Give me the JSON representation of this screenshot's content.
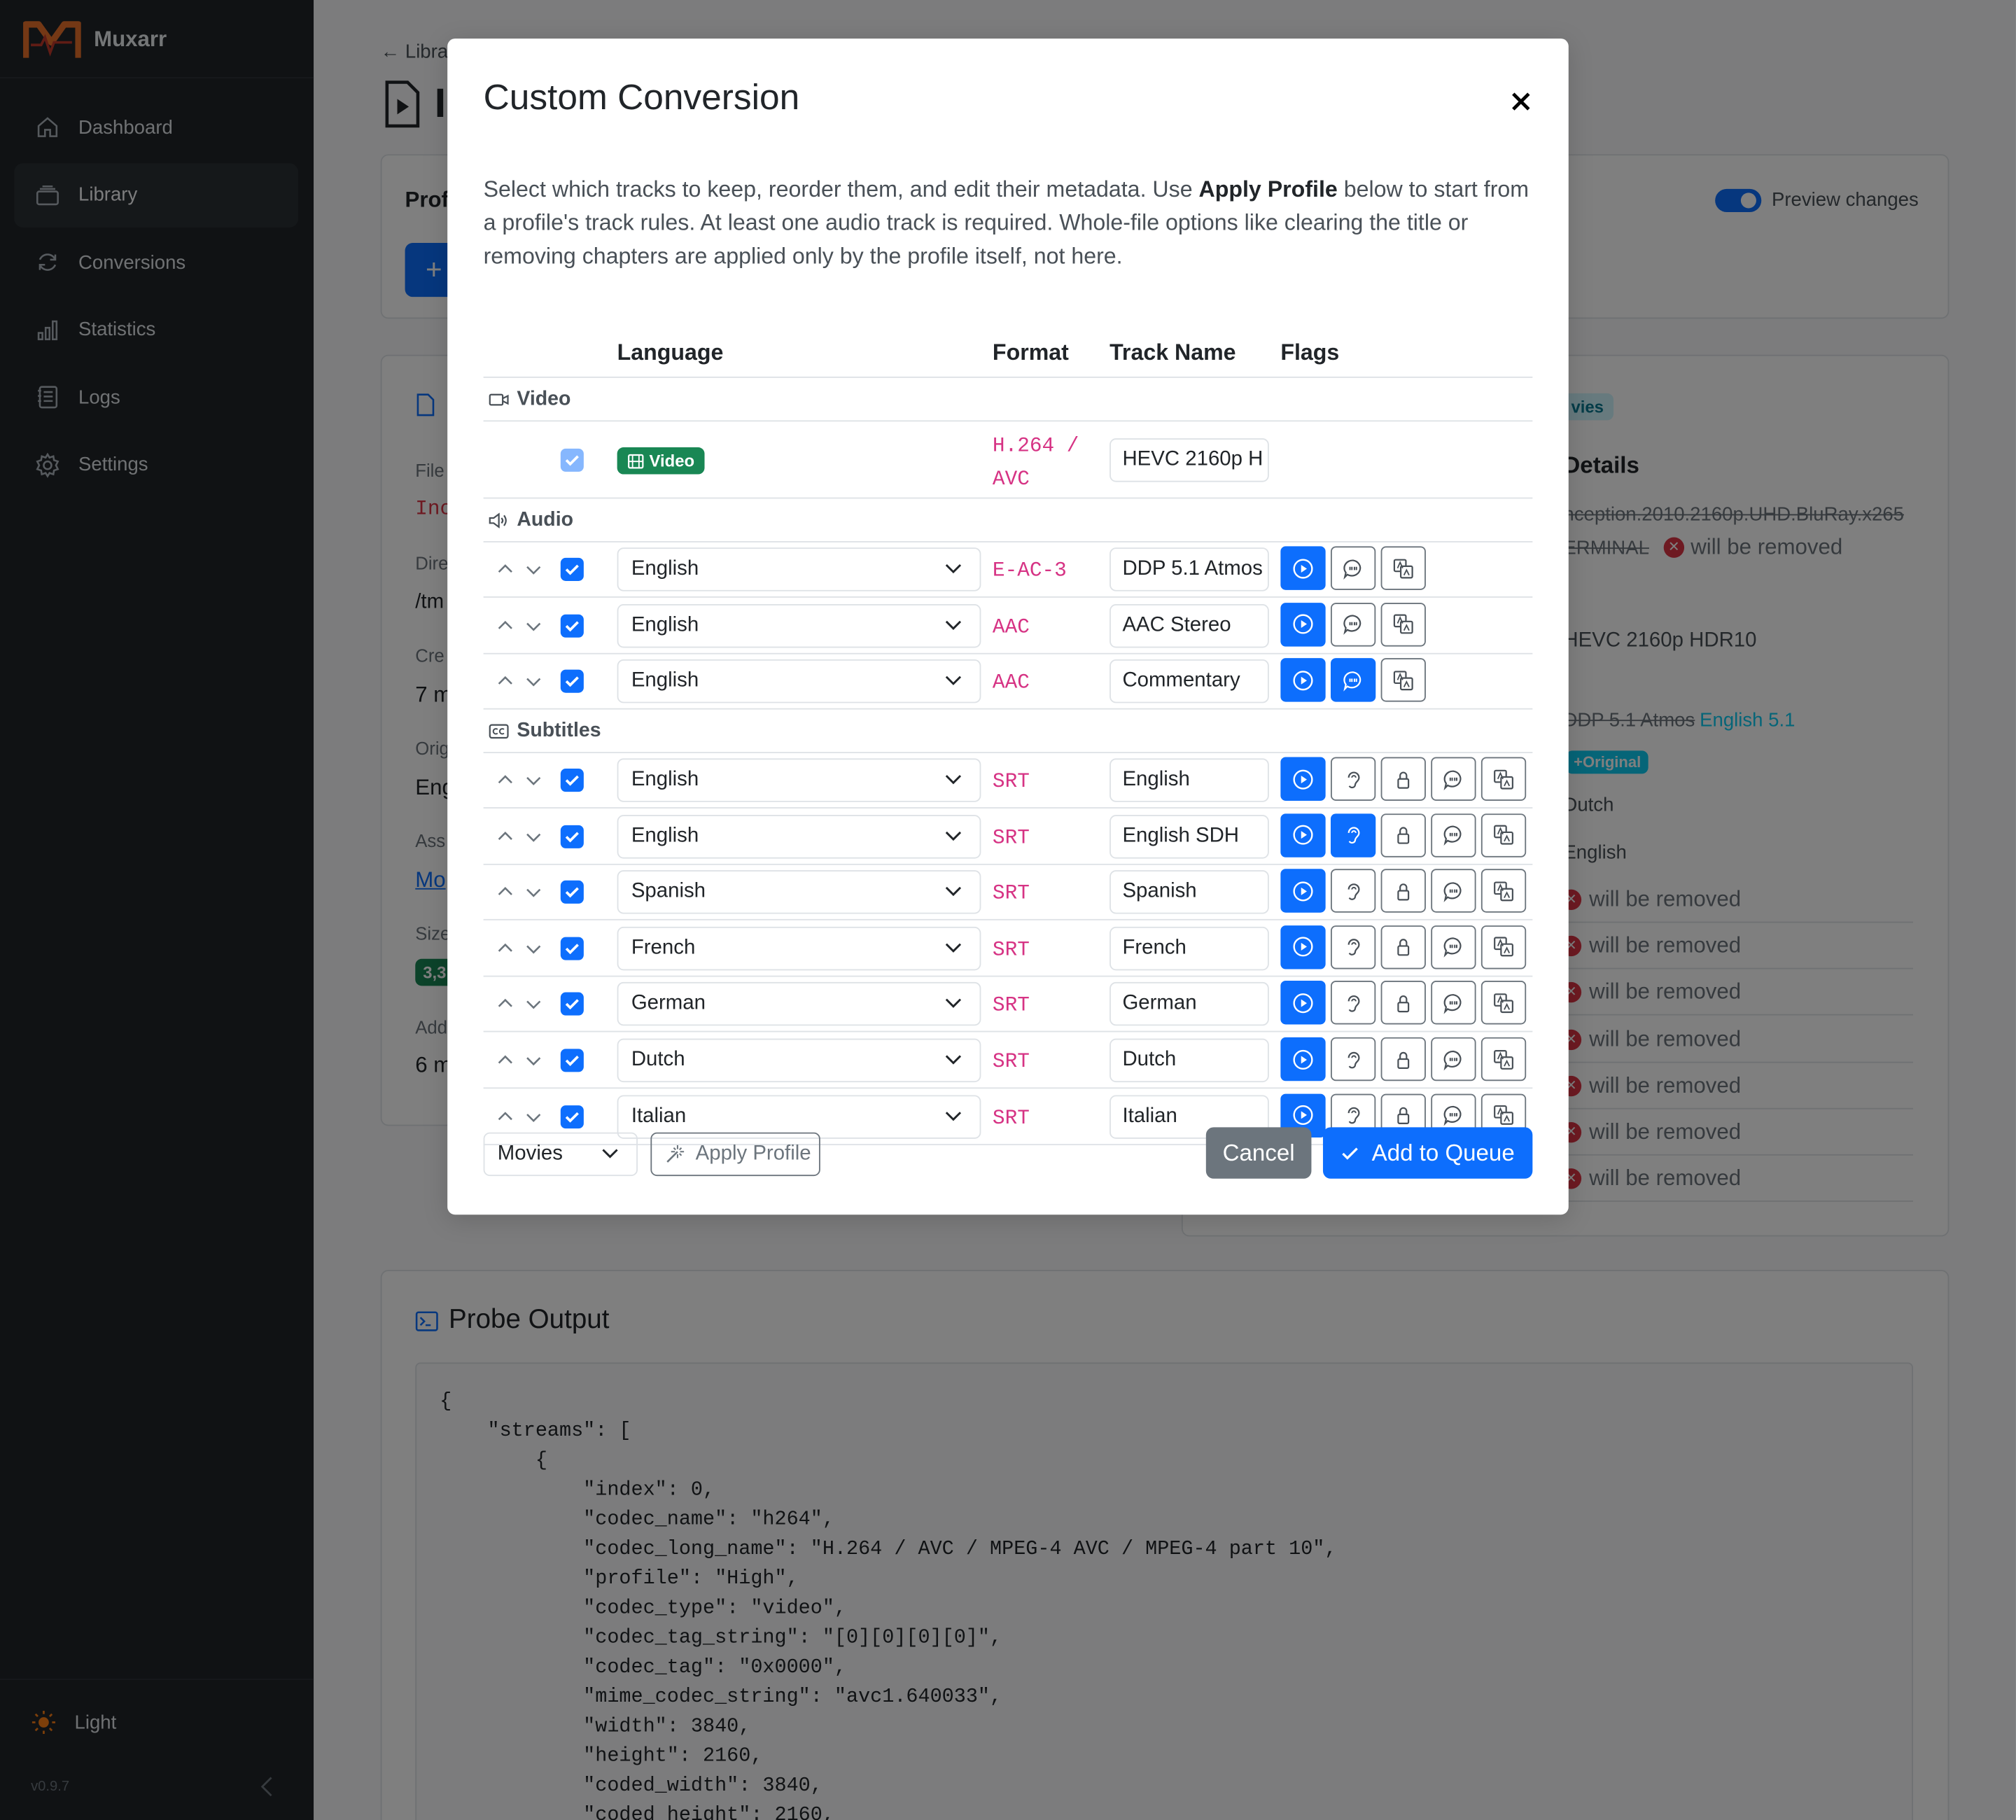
{
  "app": {
    "name": "Muxarr",
    "version": "v0.9.7",
    "theme_label": "Light"
  },
  "sidebar": {
    "items": [
      {
        "label": "Dashboard",
        "icon": "home-icon"
      },
      {
        "label": "Library",
        "icon": "library-icon"
      },
      {
        "label": "Conversions",
        "icon": "refresh-icon"
      },
      {
        "label": "Statistics",
        "icon": "bar-chart-icon"
      },
      {
        "label": "Logs",
        "icon": "log-icon"
      },
      {
        "label": "Settings",
        "icon": "gear-icon"
      }
    ]
  },
  "background": {
    "breadcrumb": "← Libra",
    "page_title_initial": "I",
    "profile_label": "Prof",
    "preview_label": "Preview changes",
    "file_info_labels": [
      "File",
      "Dire",
      "Cre",
      "Orig",
      "Ass",
      "Size",
      "Add"
    ],
    "file_info_values": [
      "Inc",
      "/tm",
      "7 m",
      "Eng",
      "Mo",
      "3,3",
      "6 m"
    ],
    "tag_partial": "vies",
    "details_title": "Details",
    "filename_partial": "nception.2010.2160p.UHD.BluRay.x265",
    "title_partial": "ERMINAL",
    "removed_label": "will be removed",
    "video_name": "HEVC 2160p HDR10",
    "audio_old": "DDP 5.1 Atmos",
    "audio_new": "English 5.1",
    "original_badge": "+Original",
    "lang_dutch": "Dutch",
    "lang_english": "English",
    "probe_title": "Probe Output",
    "probe_text": "{\n    \"streams\": [\n        {\n            \"index\": 0,\n            \"codec_name\": \"h264\",\n            \"codec_long_name\": \"H.264 / AVC / MPEG-4 AVC / MPEG-4 part 10\",\n            \"profile\": \"High\",\n            \"codec_type\": \"video\",\n            \"codec_tag_string\": \"[0][0][0][0]\",\n            \"codec_tag\": \"0x0000\",\n            \"mime_codec_string\": \"avc1.640033\",\n            \"width\": 3840,\n            \"height\": 2160,\n            \"coded_width\": 3840,\n            \"coded_height\": 2160,"
  },
  "modal": {
    "title": "Custom Conversion",
    "desc_1": "Select which tracks to keep, reorder them, and edit their metadata. Use ",
    "desc_bold": "Apply Profile",
    "desc_2": " below to start from a profile's track rules. At least one audio track is required. Whole-file options like clearing the title or removing chapters are applied only by the profile itself, not here.",
    "columns": {
      "language": "Language",
      "format": "Format",
      "track_name": "Track Name",
      "flags": "Flags"
    },
    "sections": {
      "video": "Video",
      "audio": "Audio",
      "subtitles": "Subtitles"
    },
    "video_track": {
      "badge": "Video",
      "format": "H.264 / AVC",
      "name": "HEVC 2160p H"
    },
    "audio_tracks": [
      {
        "language": "English",
        "format": "E-AC-3",
        "name": "DDP 5.1 Atmos",
        "flags": [
          true,
          false,
          false
        ]
      },
      {
        "language": "English",
        "format": "AAC",
        "name": "AAC Stereo",
        "flags": [
          true,
          false,
          false
        ]
      },
      {
        "language": "English",
        "format": "AAC",
        "name": "Commentary",
        "flags": [
          true,
          true,
          false
        ]
      }
    ],
    "subtitle_tracks": [
      {
        "language": "English",
        "format": "SRT",
        "name": "English",
        "flags": [
          true,
          false,
          false,
          false,
          false
        ]
      },
      {
        "language": "English",
        "format": "SRT",
        "name": "English SDH",
        "flags": [
          true,
          true,
          false,
          false,
          false
        ]
      },
      {
        "language": "Spanish",
        "format": "SRT",
        "name": "Spanish",
        "flags": [
          true,
          false,
          false,
          false,
          false
        ]
      },
      {
        "language": "French",
        "format": "SRT",
        "name": "French",
        "flags": [
          true,
          false,
          false,
          false,
          false
        ]
      },
      {
        "language": "German",
        "format": "SRT",
        "name": "German",
        "flags": [
          true,
          false,
          false,
          false,
          false
        ]
      },
      {
        "language": "Dutch",
        "format": "SRT",
        "name": "Dutch",
        "flags": [
          true,
          false,
          false,
          false,
          false
        ]
      },
      {
        "language": "Italian",
        "format": "SRT",
        "name": "Italian",
        "flags": [
          true,
          false,
          false,
          false,
          false
        ]
      }
    ],
    "profile_select": "Movies",
    "apply_profile": "Apply Profile",
    "cancel": "Cancel",
    "add_to_queue": "Add to Queue"
  },
  "colors": {
    "primary": "#0d6efd",
    "secondary": "#6c757d",
    "success": "#198754",
    "danger": "#dc3545",
    "code": "#d63384",
    "sidebar": "#212529"
  }
}
